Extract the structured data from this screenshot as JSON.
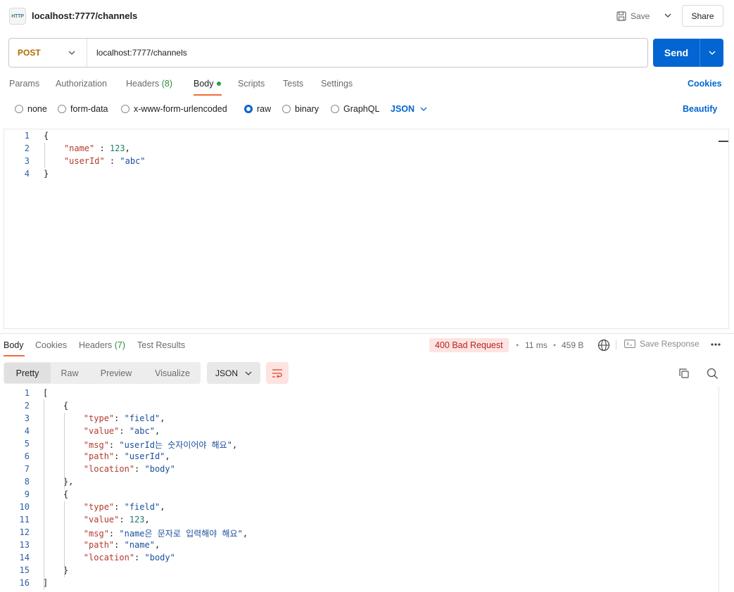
{
  "header": {
    "title": "localhost:7777/channels",
    "icon_text": "HTTP",
    "save_label": "Save",
    "share_label": "Share"
  },
  "request": {
    "method": "POST",
    "url": "localhost:7777/channels",
    "send_label": "Send"
  },
  "request_tabs": {
    "params": "Params",
    "authorization": "Authorization",
    "headers": "Headers",
    "headers_count": "(8)",
    "body": "Body",
    "scripts": "Scripts",
    "tests": "Tests",
    "settings": "Settings",
    "cookies": "Cookies"
  },
  "body_types": {
    "none": "none",
    "form_data": "form-data",
    "urlencoded": "x-www-form-urlencoded",
    "raw": "raw",
    "binary": "binary",
    "graphql": "GraphQL",
    "format": "JSON",
    "beautify": "Beautify",
    "selected": "raw"
  },
  "request_body": {
    "line_numbers": [
      "1",
      "2",
      "3",
      "4"
    ],
    "lines": [
      [
        [
          "p",
          "{"
        ]
      ],
      [
        [
          "p",
          "    "
        ],
        [
          "k",
          "\"name\""
        ],
        [
          "p",
          " : "
        ],
        [
          "n",
          "123"
        ],
        [
          "p",
          ","
        ]
      ],
      [
        [
          "p",
          "    "
        ],
        [
          "k",
          "\"userId\""
        ],
        [
          "p",
          " : "
        ],
        [
          "s",
          "\"abc\""
        ]
      ],
      [
        [
          "p",
          "}"
        ]
      ]
    ]
  },
  "response_tabs": {
    "body": "Body",
    "cookies": "Cookies",
    "headers": "Headers",
    "headers_count": "(7)",
    "test_results": "Test Results"
  },
  "response_meta": {
    "status": "400 Bad Request",
    "time": "11 ms",
    "size": "459 B",
    "save_response": "Save Response",
    "dot": "•"
  },
  "response_view": {
    "pretty": "Pretty",
    "raw": "Raw",
    "preview": "Preview",
    "visualize": "Visualize",
    "format": "JSON"
  },
  "response_body": {
    "line_numbers": [
      "1",
      "2",
      "3",
      "4",
      "5",
      "6",
      "7",
      "8",
      "9",
      "10",
      "11",
      "12",
      "13",
      "14",
      "15",
      "16"
    ],
    "lines": [
      [
        [
          "p",
          "["
        ]
      ],
      [
        [
          "p",
          "    {"
        ]
      ],
      [
        [
          "p",
          "        "
        ],
        [
          "k",
          "\"type\""
        ],
        [
          "p",
          ": "
        ],
        [
          "s",
          "\"field\""
        ],
        [
          "p",
          ","
        ]
      ],
      [
        [
          "p",
          "        "
        ],
        [
          "k",
          "\"value\""
        ],
        [
          "p",
          ": "
        ],
        [
          "s",
          "\"abc\""
        ],
        [
          "p",
          ","
        ]
      ],
      [
        [
          "p",
          "        "
        ],
        [
          "k",
          "\"msg\""
        ],
        [
          "p",
          ": "
        ],
        [
          "s",
          "\"userId는 숫자이어야 해요\""
        ],
        [
          "p",
          ","
        ]
      ],
      [
        [
          "p",
          "        "
        ],
        [
          "k",
          "\"path\""
        ],
        [
          "p",
          ": "
        ],
        [
          "s",
          "\"userId\""
        ],
        [
          "p",
          ","
        ]
      ],
      [
        [
          "p",
          "        "
        ],
        [
          "k",
          "\"location\""
        ],
        [
          "p",
          ": "
        ],
        [
          "s",
          "\"body\""
        ]
      ],
      [
        [
          "p",
          "    },"
        ]
      ],
      [
        [
          "p",
          "    {"
        ]
      ],
      [
        [
          "p",
          "        "
        ],
        [
          "k",
          "\"type\""
        ],
        [
          "p",
          ": "
        ],
        [
          "s",
          "\"field\""
        ],
        [
          "p",
          ","
        ]
      ],
      [
        [
          "p",
          "        "
        ],
        [
          "k",
          "\"value\""
        ],
        [
          "p",
          ": "
        ],
        [
          "n",
          "123"
        ],
        [
          "p",
          ","
        ]
      ],
      [
        [
          "p",
          "        "
        ],
        [
          "k",
          "\"msg\""
        ],
        [
          "p",
          ": "
        ],
        [
          "s",
          "\"name은 문자로 입력해야 해요\""
        ],
        [
          "p",
          ","
        ]
      ],
      [
        [
          "p",
          "        "
        ],
        [
          "k",
          "\"path\""
        ],
        [
          "p",
          ": "
        ],
        [
          "s",
          "\"name\""
        ],
        [
          "p",
          ","
        ]
      ],
      [
        [
          "p",
          "        "
        ],
        [
          "k",
          "\"location\""
        ],
        [
          "p",
          ": "
        ],
        [
          "s",
          "\"body\""
        ]
      ],
      [
        [
          "p",
          "    }"
        ]
      ],
      [
        [
          "p",
          "]"
        ]
      ]
    ]
  },
  "colors": {
    "accent": "#0265d2",
    "tab_underline": "#f26b3a",
    "status_bg": "#fde3e1",
    "status_text": "#b3261e",
    "method": "#b26c00"
  }
}
